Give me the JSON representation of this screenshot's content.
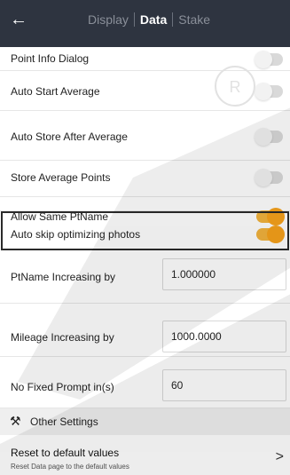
{
  "header": {
    "back_icon": "arrow-left-icon",
    "tabs": [
      {
        "label": "Display",
        "active": false
      },
      {
        "label": "Data",
        "active": true
      },
      {
        "label": "Stake",
        "active": false
      }
    ]
  },
  "toggles": [
    {
      "label": "Point Info Dialog",
      "on": false
    },
    {
      "label": "Auto Start Average",
      "on": false
    },
    {
      "label": "Auto Store After Average",
      "on": false
    },
    {
      "label": "Store Average Points",
      "on": false
    },
    {
      "label": "Allow Same PtName",
      "on": true
    },
    {
      "label": "Auto skip optimizing photos",
      "on": true
    }
  ],
  "fields": [
    {
      "label": "PtName Increasing by",
      "value": "1.000000"
    },
    {
      "label": "Mileage Increasing by",
      "value": "1000.0000"
    },
    {
      "label": "No Fixed Prompt in(s)",
      "value": "60"
    }
  ],
  "other_settings": {
    "icon": "tools-icon",
    "title": "Other Settings"
  },
  "reset": {
    "title": "Reset to default values",
    "subtitle": "Reset Data page to the default values",
    "chevron": ">"
  },
  "colors": {
    "header_bg": "#2e3440",
    "toggle_on": "#f7a21b",
    "toggle_off": "#d9d9d9"
  }
}
